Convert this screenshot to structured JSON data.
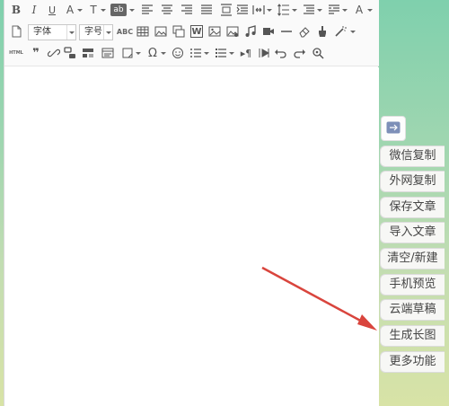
{
  "toolbar": {
    "font_family_label": "字体",
    "font_size_label": "字号",
    "html_label": "HTML",
    "abc_label": "ABC",
    "word_label": "W",
    "ab_label": "ab"
  },
  "side_panel": {
    "buttons": [
      {
        "label": "微信复制"
      },
      {
        "label": "外网复制"
      },
      {
        "label": "保存文章"
      },
      {
        "label": "导入文章"
      },
      {
        "label": "清空/新建"
      },
      {
        "label": "手机预览"
      },
      {
        "label": "云端草稿"
      },
      {
        "label": "生成长图"
      },
      {
        "label": "更多功能"
      }
    ]
  },
  "colors": {
    "arrow": "#d9453d",
    "background_top": "#7fd0ad",
    "background_bottom": "#d8e3a6"
  }
}
